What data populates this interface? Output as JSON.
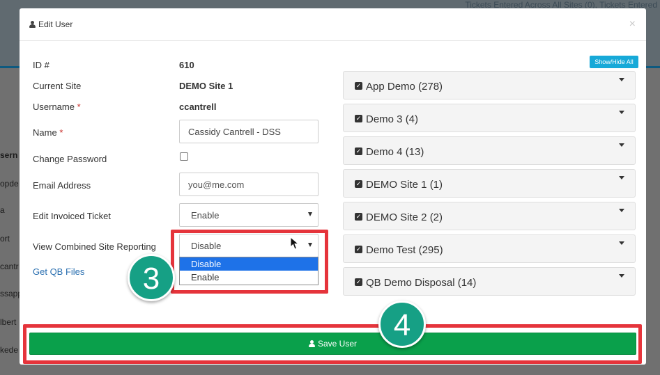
{
  "background": {
    "header_text": "Tickets Entered Across All Sites (0), Tickets Entered",
    "rows": [
      "sern",
      "opde",
      "a",
      "ort",
      "cantr",
      "ssapp",
      "lbert",
      "kede"
    ]
  },
  "modal": {
    "title": "Edit User",
    "close": "×",
    "show_hide_label": "Show/Hide All",
    "fields": {
      "id_label": "ID #",
      "id_value": "610",
      "current_site_label": "Current Site",
      "current_site_value": "DEMO Site 1",
      "username_label": "Username",
      "username_value": "ccantrell",
      "required_mark": "*",
      "name_label": "Name",
      "name_value": "Cassidy Cantrell - DSS",
      "change_password_label": "Change Password",
      "email_label": "Email Address",
      "email_placeholder": "you@me.com",
      "edit_invoiced_label": "Edit Invoiced Ticket",
      "edit_invoiced_value": "Enable",
      "combined_reporting_label": "View Combined Site Reporting",
      "combined_reporting_value": "Disable",
      "combined_reporting_options": [
        "Disable",
        "Enable"
      ],
      "qb_link": "Get QB Files"
    },
    "sites": [
      {
        "label": "App Demo (278)",
        "checked": true
      },
      {
        "label": "Demo 3 (4)",
        "checked": true
      },
      {
        "label": "Demo 4 (13)",
        "checked": true
      },
      {
        "label": "DEMO Site 1 (1)",
        "checked": true
      },
      {
        "label": "DEMO Site 2 (2)",
        "checked": true
      },
      {
        "label": "Demo Test (295)",
        "checked": true
      },
      {
        "label": "QB Demo Disposal (14)",
        "checked": true
      }
    ],
    "save_label": "Save User"
  },
  "annotations": {
    "step_3": "3",
    "step_4": "4"
  },
  "colors": {
    "highlight": "#e5343b",
    "badge": "#16a085",
    "save_button": "#0aa04b",
    "show_hide_button": "#17a9d8",
    "dropdown_selected": "#1e72e8"
  }
}
